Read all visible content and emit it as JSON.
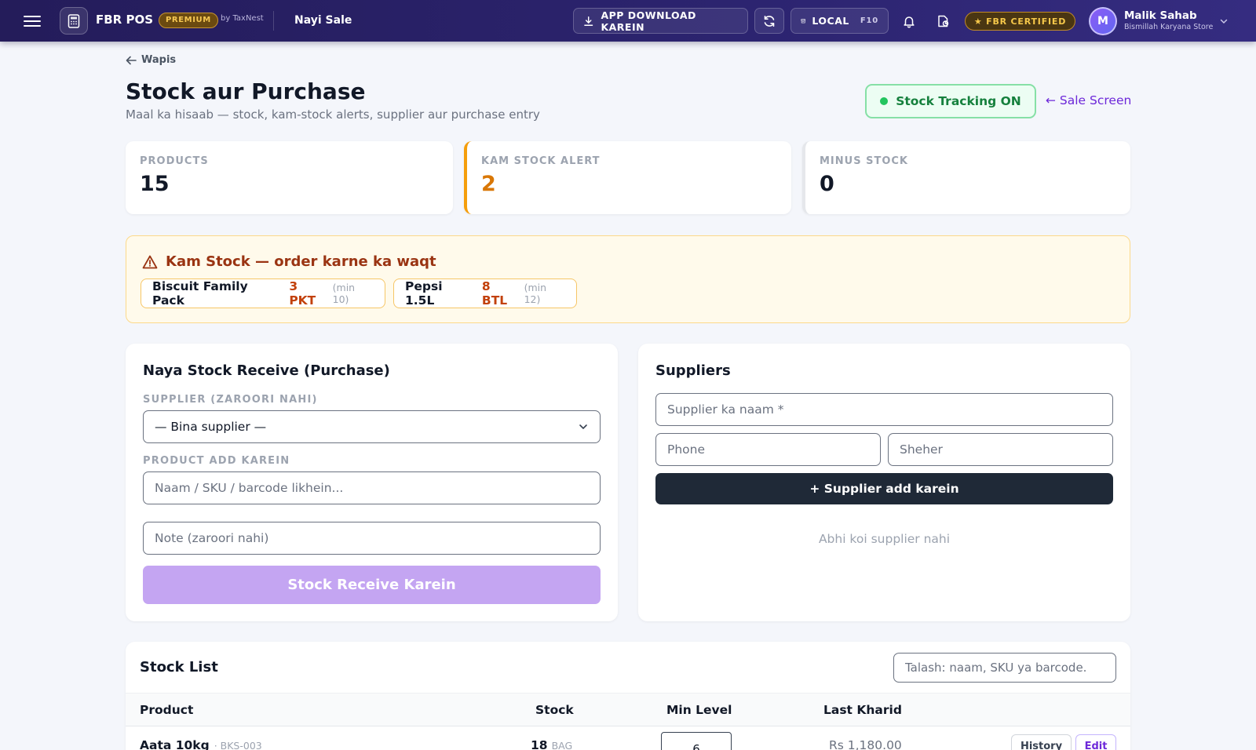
{
  "topbar": {
    "brand": "FBR POS",
    "badge": "PREMIUM",
    "by": "by TaxNest",
    "nav_label": "Nayi Sale",
    "download_label": "APP DOWNLOAD KAREIN",
    "local_label": "LOCAL",
    "local_shortcut": "F10",
    "certified_label": "★ FBR CERTIFIED",
    "user": {
      "initial": "M",
      "name": "Malik Sahab",
      "store": "Bismillah Karyana Store"
    }
  },
  "page": {
    "back_label": "Wapis",
    "title": "Stock aur Purchase",
    "subtitle": "Maal ka hisaab — stock, kam-stock alerts, supplier aur purchase entry",
    "tracking_label": "Stock Tracking ON",
    "sale_link": "← Sale Screen"
  },
  "stats": [
    {
      "label": "PRODUCTS",
      "value": "15"
    },
    {
      "label": "KAM STOCK ALERT",
      "value": "2"
    },
    {
      "label": "MINUS STOCK",
      "value": "0"
    }
  ],
  "alert": {
    "title": "Kam Stock — order karne ka waqt",
    "items": [
      {
        "name": "Biscuit Family Pack",
        "qty": "3 PKT",
        "min": "(min 10)"
      },
      {
        "name": "Pepsi 1.5L",
        "qty": "8 BTL",
        "min": "(min 12)"
      }
    ]
  },
  "purchase": {
    "title": "Naya Stock Receive (Purchase)",
    "supplier_label": "SUPPLIER (ZAROORI NAHI)",
    "supplier_value": "— Bina supplier —",
    "product_label": "PRODUCT ADD KAREIN",
    "product_placeholder": "Naam / SKU / barcode likhein...",
    "note_placeholder": "Note (zaroori nahi)",
    "submit_label": "Stock Receive Karein"
  },
  "suppliers": {
    "title": "Suppliers",
    "name_placeholder": "Supplier ka naam *",
    "phone_placeholder": "Phone",
    "city_placeholder": "Sheher",
    "add_label": "+ Supplier add karein",
    "empty_text": "Abhi koi supplier nahi"
  },
  "stock_list": {
    "title": "Stock List",
    "search_placeholder": "Talash: naam, SKU ya barcode.",
    "columns": [
      "Product",
      "Stock",
      "Min Level",
      "Last Kharid"
    ],
    "rows": [
      {
        "name": "Aata 10kg",
        "sku": "· BKS-003",
        "stock": "18",
        "unit": "BAG",
        "min": "6",
        "last": "Rs 1,180.00",
        "history_label": "History",
        "edit_label": "Edit"
      }
    ]
  },
  "colors": {
    "topbar": "#2c2470",
    "accent": "#6d28d9",
    "alert_bg": "#fffaeb",
    "success": "#15803d"
  }
}
